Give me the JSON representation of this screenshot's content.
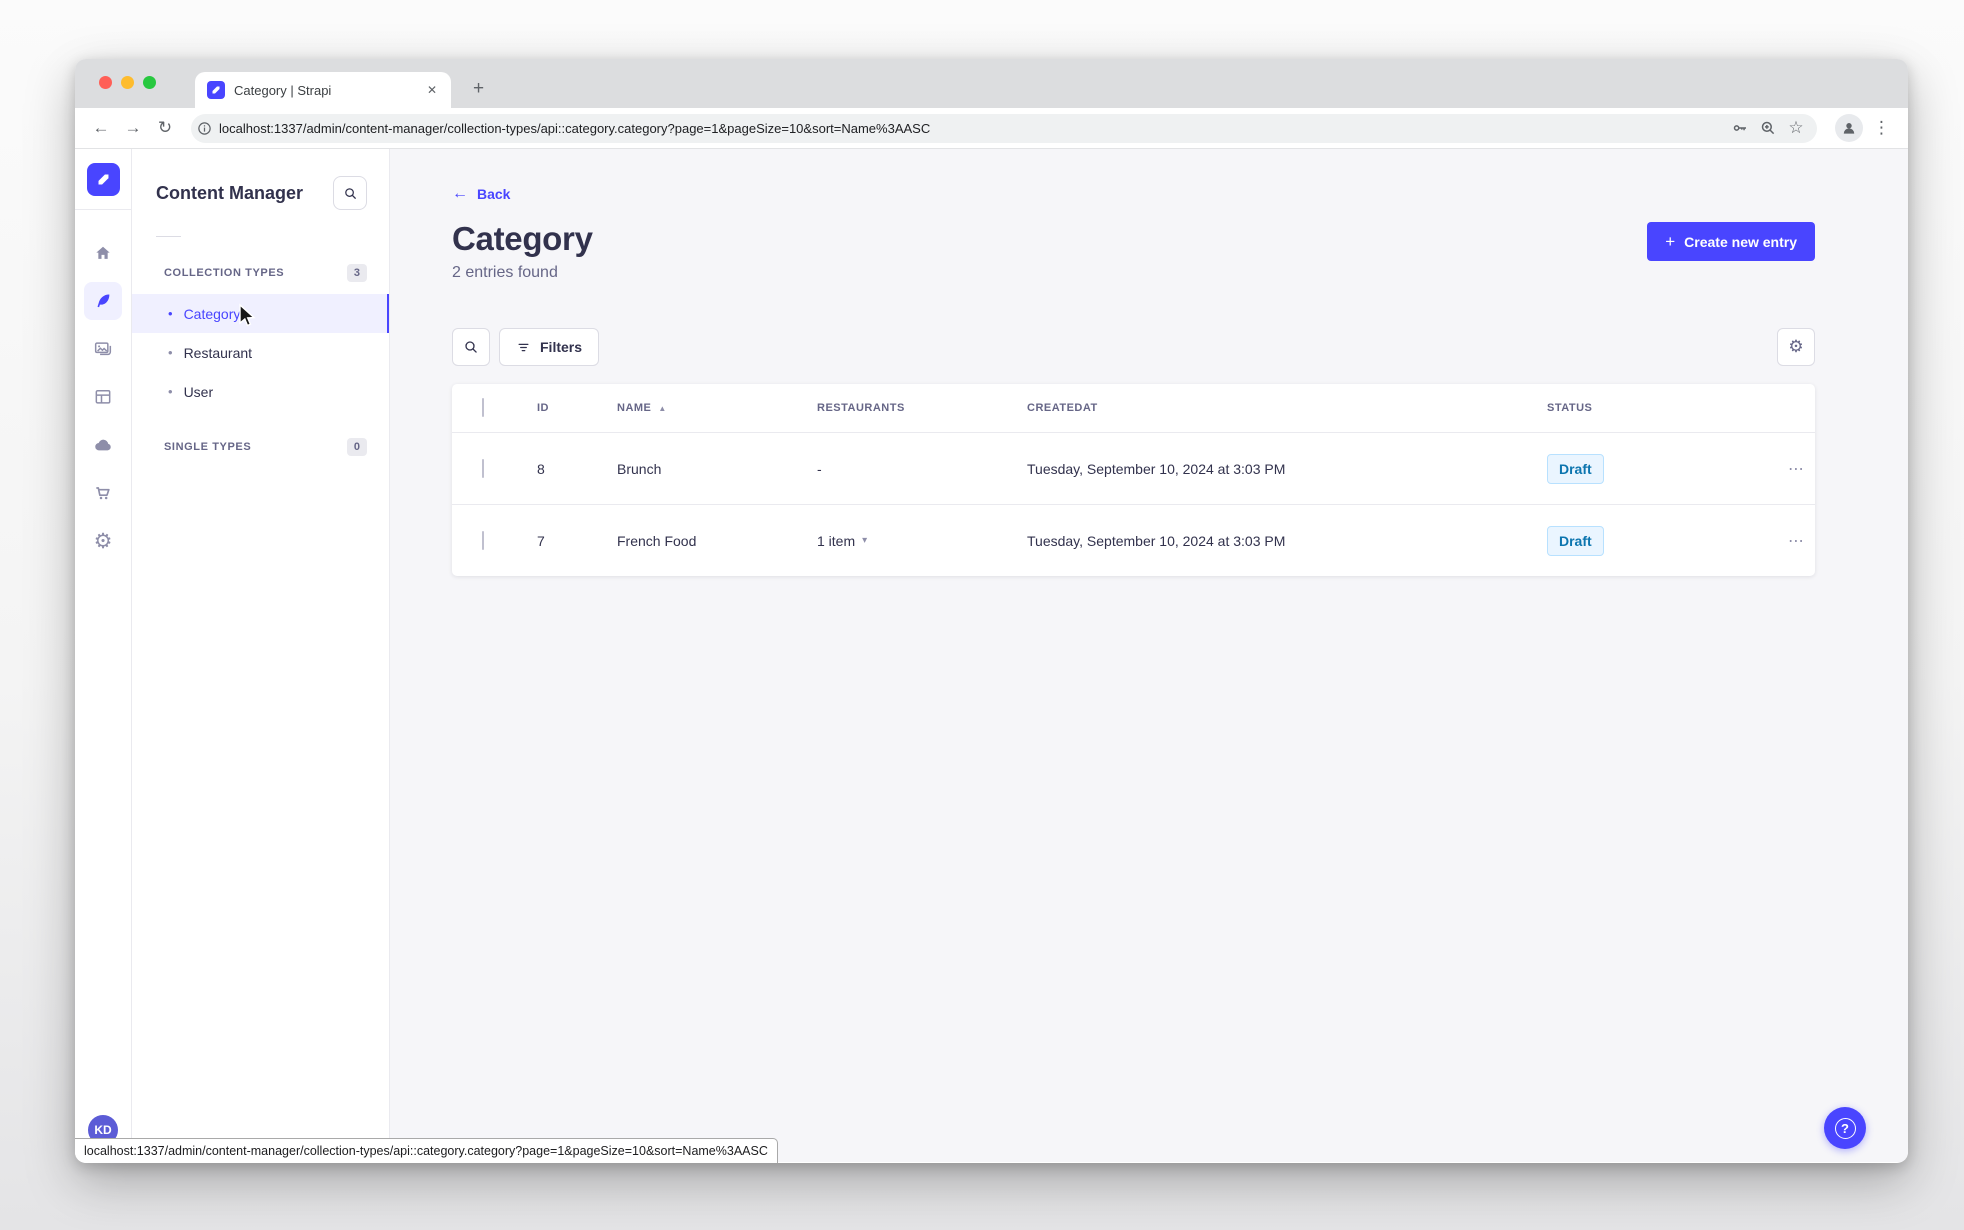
{
  "browser": {
    "tab": {
      "title": "Category | Strapi"
    },
    "url": "localhost:1337/admin/content-manager/collection-types/api::category.category?page=1&pageSize=10&sort=Name%3AASC",
    "status_bar_url": "localhost:1337/admin/content-manager/collection-types/api::category.category?page=1&pageSize=10&sort=Name%3AASC"
  },
  "icons": {
    "close": "✕",
    "plus": "+",
    "back": "←",
    "forward": "→",
    "reload": "↻",
    "star": "☆",
    "more_v": "⋮",
    "more_h": "⋯",
    "sort_asc": "▲",
    "chevron_down": "▾",
    "gear": "⚙",
    "bullet": "•",
    "help": "?",
    "rail_icon_names": [
      "strapi-logo",
      "home",
      "content-manager",
      "media-library",
      "content-type-builder",
      "cloud",
      "marketplace",
      "settings"
    ]
  },
  "sidebar": {
    "avatar_initials": "KD"
  },
  "panel": {
    "title": "Content Manager",
    "collection_types": {
      "label": "COLLECTION TYPES",
      "count": "3",
      "items": [
        {
          "label": "Category",
          "active": true
        },
        {
          "label": "Restaurant",
          "active": false
        },
        {
          "label": "User",
          "active": false
        }
      ]
    },
    "single_types": {
      "label": "SINGLE TYPES",
      "count": "0"
    }
  },
  "main": {
    "back_label": "Back",
    "title": "Category",
    "subtitle": "2 entries found",
    "create_button_label": "Create new entry",
    "filters_button_label": "Filters",
    "table": {
      "headers": [
        "ID",
        "NAME",
        "RESTAURANTS",
        "CREATEDAT",
        "STATUS"
      ],
      "sorted_by": "NAME",
      "sort_direction": "ascending",
      "rows": [
        {
          "id": "8",
          "name": "Brunch",
          "restaurants": "-",
          "createdat": "Tuesday, September 10, 2024 at 3:03 PM",
          "status": "Draft"
        },
        {
          "id": "7",
          "name": "French Food",
          "restaurants": "1 item",
          "createdat": "Tuesday, September 10, 2024 at 3:03 PM",
          "status": "Draft"
        }
      ]
    }
  },
  "colors": {
    "accent": "#4945ff",
    "active_item_bg": "#f0f0ff",
    "draft_bg": "#eaf5ff",
    "draft_border": "#b8e1ff",
    "draft_text": "#0c75af",
    "text_primary": "#32324d",
    "text_secondary": "#666687",
    "main_bg": "#f6f6f9"
  }
}
